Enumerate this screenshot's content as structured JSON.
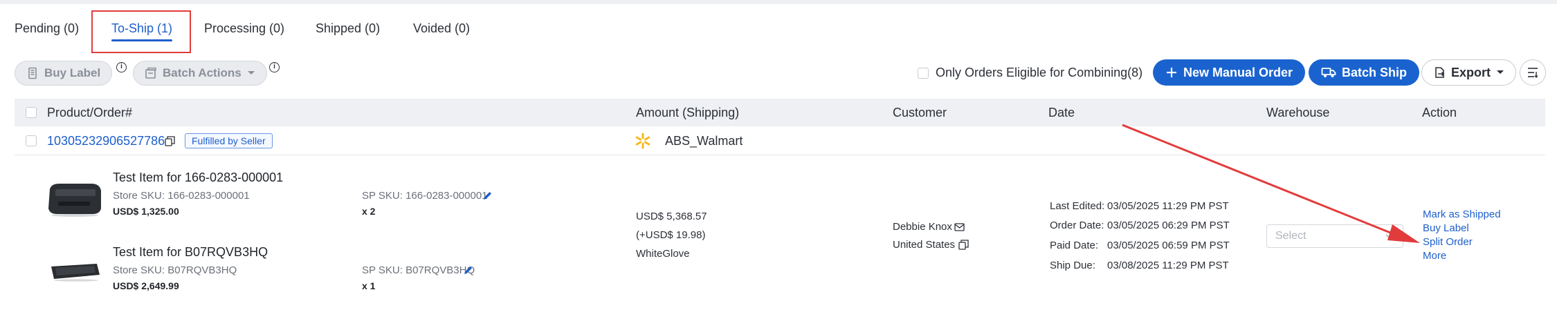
{
  "tabs": [
    {
      "label": "Pending (0)",
      "active": false
    },
    {
      "label": "To-Ship (1)",
      "active": true
    },
    {
      "label": "Processing (0)",
      "active": false
    },
    {
      "label": "Shipped (0)",
      "active": false
    },
    {
      "label": "Voided (0)",
      "active": false
    }
  ],
  "toolbar": {
    "buy_label": "Buy Label",
    "batch_actions": "Batch Actions",
    "only_orders_eligible": "Only Orders Eligible for Combining(8)",
    "new_manual_order": "New Manual Order",
    "batch_ship": "Batch Ship",
    "export": "Export"
  },
  "table": {
    "headers": {
      "product": "Product/Order#",
      "amount": "Amount (Shipping)",
      "customer": "Customer",
      "date": "Date",
      "warehouse": "Warehouse",
      "action": "Action"
    },
    "order": {
      "number": "10305232906527786",
      "badge": "Fulfilled by Seller",
      "store": "ABS_Walmart",
      "items": [
        {
          "name": "Test Item for 166-0283-000001",
          "store_sku": "Store SKU: 166-0283-000001",
          "price": "USD$ 1,325.00",
          "sp_sku": "SP SKU: 166-0283-000001",
          "qty": "x 2"
        },
        {
          "name": "Test Item for B07RQVB3HQ",
          "store_sku": "Store SKU: B07RQVB3HQ",
          "price": "USD$ 2,649.99",
          "sp_sku": "SP SKU: B07RQVB3HQ",
          "qty": "x 1"
        }
      ],
      "amount": "USD$ 5,368.57",
      "shipping": "(+USD$ 19.98)",
      "shipping_method": "WhiteGlove",
      "customer_name": "Debbie Knox",
      "customer_country": "United States",
      "dates": [
        {
          "label": "Last Edited:",
          "value": "03/05/2025 11:29 PM PST"
        },
        {
          "label": "Order Date:",
          "value": "03/05/2025 06:29 PM PST"
        },
        {
          "label": "Paid Date:",
          "value": "03/05/2025 06:59 PM PST"
        },
        {
          "label": "Ship Due:",
          "value": "03/08/2025 11:29 PM PST"
        }
      ],
      "warehouse_placeholder": "Select",
      "actions": [
        "Mark as Shipped",
        "Buy Label",
        "Split Order",
        "More"
      ]
    }
  },
  "colors": {
    "accent": "#1a63cf",
    "annotation": "#e23b3b",
    "walmart_spark": "#f5b81c"
  }
}
